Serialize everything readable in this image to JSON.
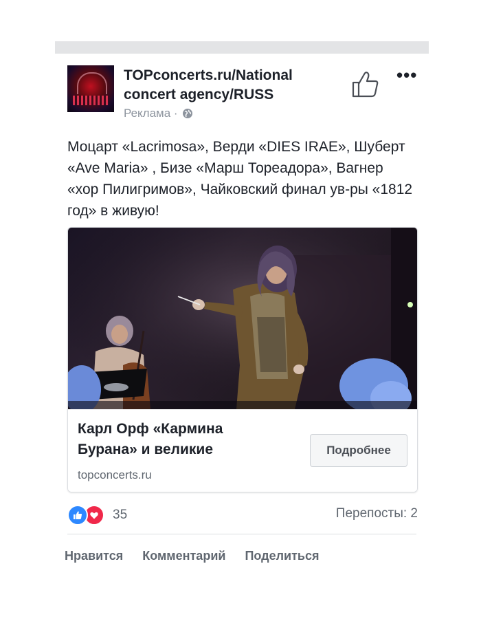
{
  "post": {
    "page_name": "TOPconcerts.ru/National concert agency/RUSS",
    "sponsored_label": "Реклама ·",
    "text": "Моцарт «Lacrimosa», Верди «DIES IRAE», Шуберт «Ave Maria» , Бизе «Марш Тореадора», Вагнер «хор Пилигримов», Чайковский финал ув-ры «1812 год» в живую!",
    "icons": {
      "avatar": "page-avatar",
      "globe": "globe-icon",
      "like_page": "thumbs-up-icon",
      "more": "more-options-icon"
    },
    "more_label": "•••"
  },
  "link_preview": {
    "title": "Карл Орф «Кармина Бурана» и великие",
    "domain": "topconcerts.ru",
    "cta_label": "Подробнее"
  },
  "reactions": {
    "count": "35",
    "shares": "Перепосты: 2",
    "types": [
      "like",
      "love"
    ]
  },
  "actions": {
    "like": "Нравится",
    "comment": "Комментарий",
    "share": "Поделиться"
  },
  "colors": {
    "like_blue": "#2d88ff",
    "love_red": "#f0284a",
    "text_primary": "#1d2129",
    "text_secondary": "#606770"
  }
}
